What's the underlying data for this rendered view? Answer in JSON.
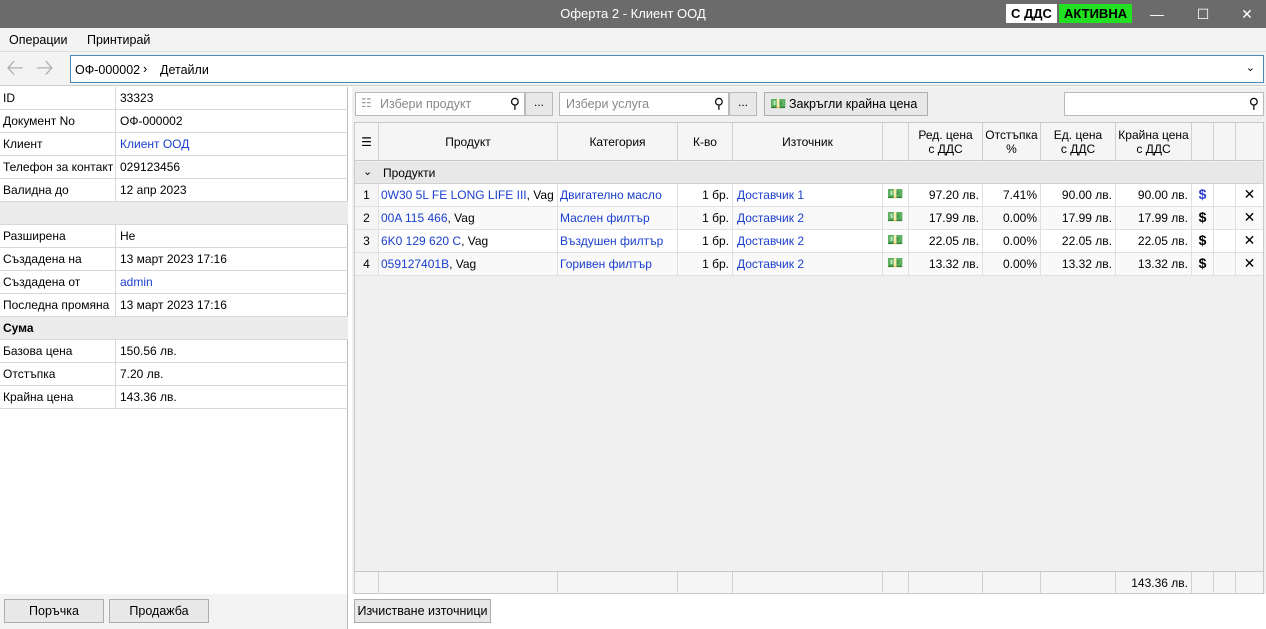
{
  "window": {
    "title": "Оферта 2 - Клиент ООД",
    "vat_badge": "С ДДС",
    "status_badge": "АКТИВНА"
  },
  "menu": {
    "items": [
      "Операции",
      "Принтирай"
    ]
  },
  "breadcrumb": {
    "doc": "ОФ-000002",
    "page": "Детайли"
  },
  "details": {
    "rows": [
      {
        "label": "ID",
        "value": "33323"
      },
      {
        "label": "Документ No",
        "value": "ОФ-000002"
      },
      {
        "label": "Клиент",
        "value": "Клиент ООД"
      },
      {
        "label": "Телефон за контакт",
        "value": "029123456"
      },
      {
        "label": "Валидна до",
        "value": "12 апр 2023"
      }
    ],
    "rows2": [
      {
        "label": "Разширена",
        "value": "Не"
      },
      {
        "label": "Създадена на",
        "value": "13 март 2023 17:16"
      },
      {
        "label": "Създадена от",
        "value": "admin"
      },
      {
        "label": "Последна промяна",
        "value": "13 март 2023 17:16"
      }
    ],
    "sum_group": "Сума",
    "sums": [
      {
        "label": "Базова цена",
        "value": "150.56 лв."
      },
      {
        "label": "Отстъпка",
        "value": "7.20 лв."
      },
      {
        "label": "Крайна цена",
        "value": "143.36 лв."
      }
    ]
  },
  "footer": {
    "order_button": "Поръчка",
    "sale_button": "Продажба",
    "clear_sources_button": "Изчистване източници"
  },
  "toolbar": {
    "product_placeholder": "Избери продукт",
    "service_placeholder": "Избери услуга",
    "more": "...",
    "round_button": "Закръгли крайна цена"
  },
  "grid": {
    "headers": [
      "Продукт",
      "Категория",
      "К-во",
      "Източник",
      "Ред. цена\nс ДДС",
      "Отстъпка\n%",
      "Ед. цена\nс ДДС",
      "Крайна цена\nс ДДС"
    ],
    "group": "Продукти",
    "rows": [
      {
        "n": "1",
        "code": "0W30 5L FE LONG LIFE III",
        "brand": ", Vag",
        "cat": "Двигателно масло",
        "qty": "1 бр.",
        "src": "Доставчик 1",
        "price": "97.20 лв.",
        "disc": "7.41%",
        "unit": "90.00 лв.",
        "total": "90.00 лв."
      },
      {
        "n": "2",
        "code": "00A 115 466",
        "brand": ", Vag",
        "cat": "Маслен филтър",
        "qty": "1 бр.",
        "src": "Доставчик 2",
        "price": "17.99 лв.",
        "disc": "0.00%",
        "unit": "17.99 лв.",
        "total": "17.99 лв."
      },
      {
        "n": "3",
        "code": "6K0 129 620 C",
        "brand": ", Vag",
        "cat": "Въздушен филтър",
        "qty": "1 бр.",
        "src": "Доставчик 2",
        "price": "22.05 лв.",
        "disc": "0.00%",
        "unit": "22.05 лв.",
        "total": "22.05 лв."
      },
      {
        "n": "4",
        "code": "059127401B",
        "brand": ", Vag",
        "cat": "Горивен филтър",
        "qty": "1 бр.",
        "src": "Доставчик 2",
        "price": "13.32 лв.",
        "disc": "0.00%",
        "unit": "13.32 лв.",
        "total": "13.32 лв."
      }
    ],
    "total": "143.36 лв."
  }
}
